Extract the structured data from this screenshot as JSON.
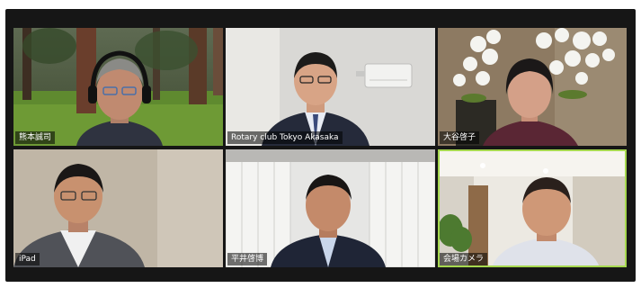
{
  "participants": [
    {
      "name": "熊本誠司",
      "role": "participant",
      "video": "forest-background"
    },
    {
      "name": "Rotary club Tokyo Akasaka",
      "role": "participant",
      "video": "office-wall"
    },
    {
      "name": "大谷啓子",
      "role": "participant",
      "video": "orchid-flowers"
    },
    {
      "name": "iPad",
      "role": "participant",
      "video": "beige-wall"
    },
    {
      "name": "平井啓博",
      "role": "participant",
      "video": "window-blinds"
    },
    {
      "name": "会場カメラ",
      "role": "active-speaker",
      "video": "conference-room"
    }
  ],
  "colors": {
    "window_bg": "#161616",
    "active_speaker_border": "#a6d84f",
    "name_tag_text": "#ffffff"
  }
}
